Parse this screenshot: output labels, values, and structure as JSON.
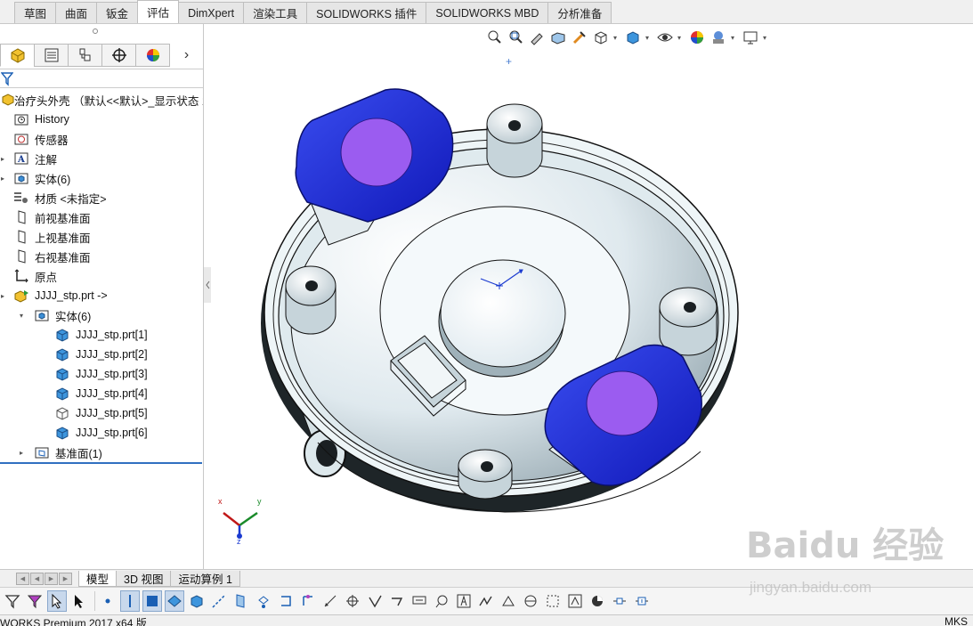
{
  "command_tabs": [
    {
      "label": "草图",
      "active": false
    },
    {
      "label": "曲面",
      "active": false
    },
    {
      "label": "钣金",
      "active": false
    },
    {
      "label": "评估",
      "active": true
    },
    {
      "label": "DimXpert",
      "active": false
    },
    {
      "label": "渲染工具",
      "active": false
    },
    {
      "label": "SOLIDWORKS 插件",
      "active": false
    },
    {
      "label": "SOLIDWORKS MBD",
      "active": false
    },
    {
      "label": "分析准备",
      "active": false
    }
  ],
  "manager_tabs": [
    "feature-manager-icon",
    "property-manager-icon",
    "configuration-manager-icon",
    "dimxpert-manager-icon",
    "display-manager-icon"
  ],
  "feature_tree": {
    "root": "治疗头外壳 （默认<<默认>_显示状态 1",
    "history": "History",
    "sensors": "传感器",
    "annotations": "注解",
    "solid_bodies": "实体(6)",
    "material": "材质 <未指定>",
    "front_plane": "前视基准面",
    "top_plane": "上视基准面",
    "right_plane": "右视基准面",
    "origin": "原点",
    "part": "JJJJ_stp.prt ->",
    "part_bodies": "实体(6)",
    "bodies": [
      "JJJJ_stp.prt[1]",
      "JJJJ_stp.prt[2]",
      "JJJJ_stp.prt[3]",
      "JJJJ_stp.prt[4]",
      "JJJJ_stp.prt[5]",
      "JJJJ_stp.prt[6]"
    ],
    "datum_planes": "基准面(1)"
  },
  "bottom_tabs": [
    {
      "label": "模型",
      "active": true
    },
    {
      "label": "3D 视图",
      "active": false
    },
    {
      "label": "运动算例 1",
      "active": false
    }
  ],
  "triad": {
    "x": "x",
    "y": "y",
    "z": "z"
  },
  "status": {
    "left": "WORKS Premium 2017 x64 版",
    "right": "MKS"
  },
  "watermark": {
    "logo": "Baidu 经验",
    "url": "jingyan.baidu.com"
  },
  "colors": {
    "accent_blue": "#1f2fd8",
    "button_purple": "#9a5cf0",
    "housing": "#e8f2f4",
    "selection_line": "#3070c0"
  }
}
